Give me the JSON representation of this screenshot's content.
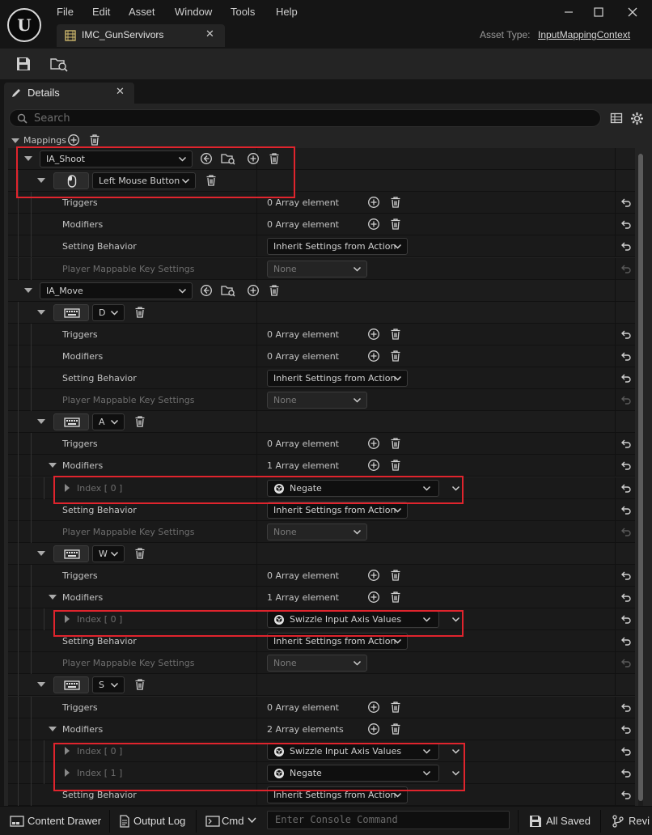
{
  "menu": [
    "File",
    "Edit",
    "Asset",
    "Window",
    "Tools",
    "Help"
  ],
  "document_tab": "IMC_GunServivors",
  "asset_type": {
    "label": "Asset Type:",
    "value": "InputMappingContext"
  },
  "details_tab": "Details",
  "search_placeholder": "Search",
  "mappings_label": "Mappings",
  "rows": [
    {
      "kind": "action",
      "depth": 1,
      "action": "IA_Shoot",
      "expanded": true
    },
    {
      "kind": "key",
      "depth": 2,
      "key": "Left Mouse Button",
      "icon": "mouse-icon",
      "expanded": true
    },
    {
      "kind": "array",
      "depth": 3,
      "label": "Triggers",
      "value": "0 Array element"
    },
    {
      "kind": "array",
      "depth": 3,
      "label": "Modifiers",
      "value": "0 Array element"
    },
    {
      "kind": "combo",
      "depth": 3,
      "label": "Setting Behavior",
      "value": "Inherit Settings from Action"
    },
    {
      "kind": "combo",
      "depth": 3,
      "label": "Player Mappable Key Settings",
      "value": "None",
      "disabled": true
    },
    {
      "kind": "action",
      "depth": 1,
      "action": "IA_Move",
      "expanded": true
    },
    {
      "kind": "key",
      "depth": 2,
      "key": "D",
      "icon": "keyboard-icon",
      "expanded": true
    },
    {
      "kind": "array",
      "depth": 3,
      "label": "Triggers",
      "value": "0 Array element"
    },
    {
      "kind": "array",
      "depth": 3,
      "label": "Modifiers",
      "value": "0 Array element"
    },
    {
      "kind": "combo",
      "depth": 3,
      "label": "Setting Behavior",
      "value": "Inherit Settings from Action"
    },
    {
      "kind": "combo",
      "depth": 3,
      "label": "Player Mappable Key Settings",
      "value": "None",
      "disabled": true
    },
    {
      "kind": "key",
      "depth": 2,
      "key": "A",
      "icon": "keyboard-icon",
      "expanded": true
    },
    {
      "kind": "array",
      "depth": 3,
      "label": "Triggers",
      "value": "0 Array element"
    },
    {
      "kind": "array",
      "depth": 3,
      "label": "Modifiers",
      "value": "1 Array element",
      "expanded": true
    },
    {
      "kind": "index",
      "depth": 4,
      "label": "Index [ 0 ]",
      "value": "Negate"
    },
    {
      "kind": "combo",
      "depth": 3,
      "label": "Setting Behavior",
      "value": "Inherit Settings from Action"
    },
    {
      "kind": "combo",
      "depth": 3,
      "label": "Player Mappable Key Settings",
      "value": "None",
      "disabled": true
    },
    {
      "kind": "key",
      "depth": 2,
      "key": "W",
      "icon": "keyboard-icon",
      "expanded": true
    },
    {
      "kind": "array",
      "depth": 3,
      "label": "Triggers",
      "value": "0 Array element"
    },
    {
      "kind": "array",
      "depth": 3,
      "label": "Modifiers",
      "value": "1 Array element",
      "expanded": true
    },
    {
      "kind": "index",
      "depth": 4,
      "label": "Index [ 0 ]",
      "value": "Swizzle Input Axis Values"
    },
    {
      "kind": "combo",
      "depth": 3,
      "label": "Setting Behavior",
      "value": "Inherit Settings from Action"
    },
    {
      "kind": "combo",
      "depth": 3,
      "label": "Player Mappable Key Settings",
      "value": "None",
      "disabled": true
    },
    {
      "kind": "key",
      "depth": 2,
      "key": "S",
      "icon": "keyboard-icon",
      "expanded": true
    },
    {
      "kind": "array",
      "depth": 3,
      "label": "Triggers",
      "value": "0 Array element"
    },
    {
      "kind": "array",
      "depth": 3,
      "label": "Modifiers",
      "value": "2 Array elements",
      "expanded": true
    },
    {
      "kind": "index",
      "depth": 4,
      "label": "Index [ 0 ]",
      "value": "Swizzle Input Axis Values"
    },
    {
      "kind": "index",
      "depth": 4,
      "label": "Index [ 1 ]",
      "value": "Negate"
    },
    {
      "kind": "combo",
      "depth": 3,
      "label": "Setting Behavior",
      "value": "Inherit Settings from Action"
    }
  ],
  "status_bar": {
    "content_drawer": "Content Drawer",
    "output_log": "Output Log",
    "cmd": "Cmd",
    "console_placeholder": "Enter Console Command",
    "all_saved": "All Saved",
    "revision": "Revi"
  },
  "colors": {
    "highlight": "#e0242d",
    "panel": "#242424",
    "row": "#1a1a1a"
  }
}
